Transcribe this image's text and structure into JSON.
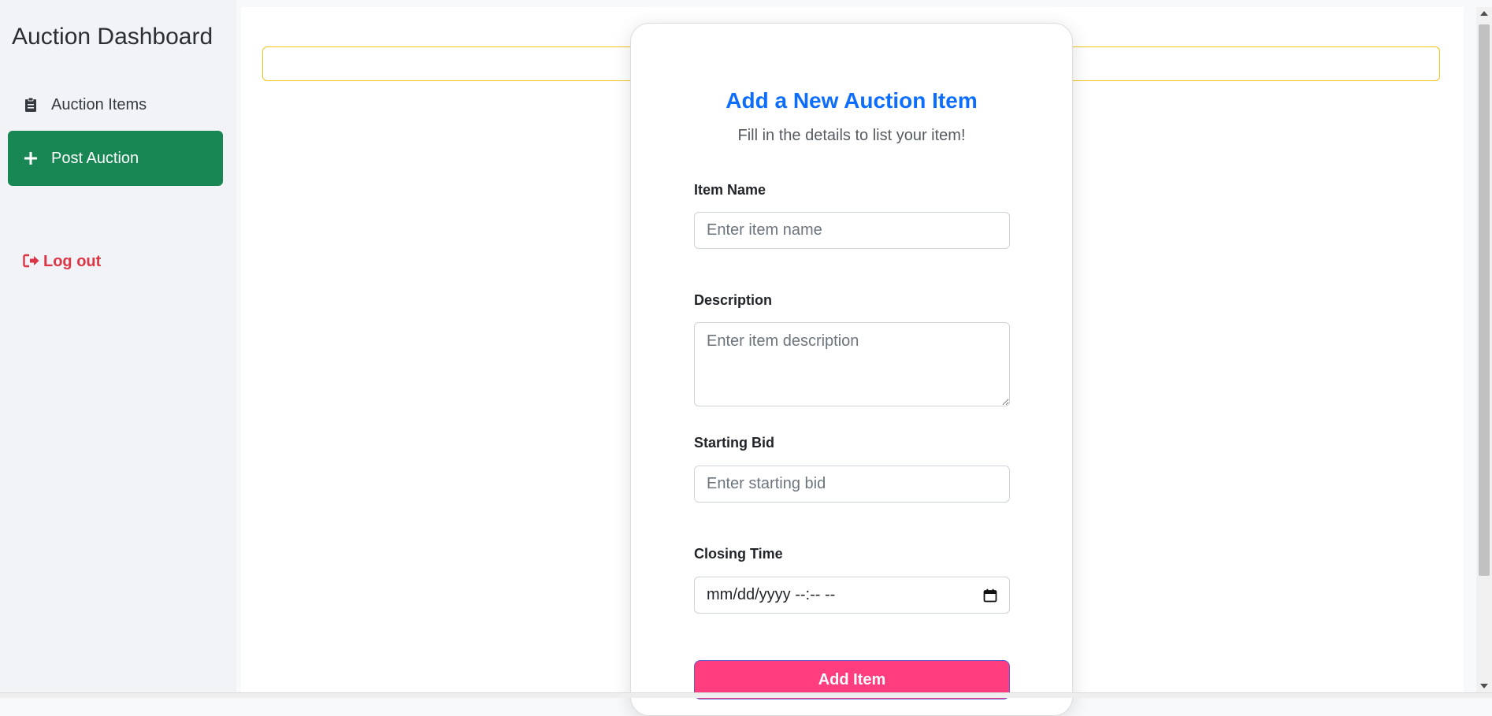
{
  "sidebar": {
    "brand": "Auction Dashboard",
    "items": [
      {
        "label": "Auction Items",
        "icon": "clipboard-icon"
      },
      {
        "label": "Post Auction",
        "icon": "plus-icon"
      }
    ],
    "logout": {
      "label": "Log out",
      "icon": "logout-icon"
    }
  },
  "form": {
    "title": "Add a New Auction Item",
    "subtitle": "Fill in the details to list your item!",
    "fields": {
      "item_name": {
        "label": "Item Name",
        "placeholder": "Enter item name"
      },
      "description": {
        "label": "Description",
        "placeholder": "Enter item description"
      },
      "starting_bid": {
        "label": "Starting Bid",
        "placeholder": "Enter starting bid"
      },
      "closing_time": {
        "label": "Closing Time",
        "value": "mm/dd/yyyy --:-- --"
      }
    },
    "submit_label": "Add Item"
  },
  "colors": {
    "brand_green": "#198754",
    "title_blue": "#0d6efd",
    "submit_pink": "#ff3d7f",
    "logout_red": "#dc3545",
    "alert_border": "#f0c419"
  }
}
